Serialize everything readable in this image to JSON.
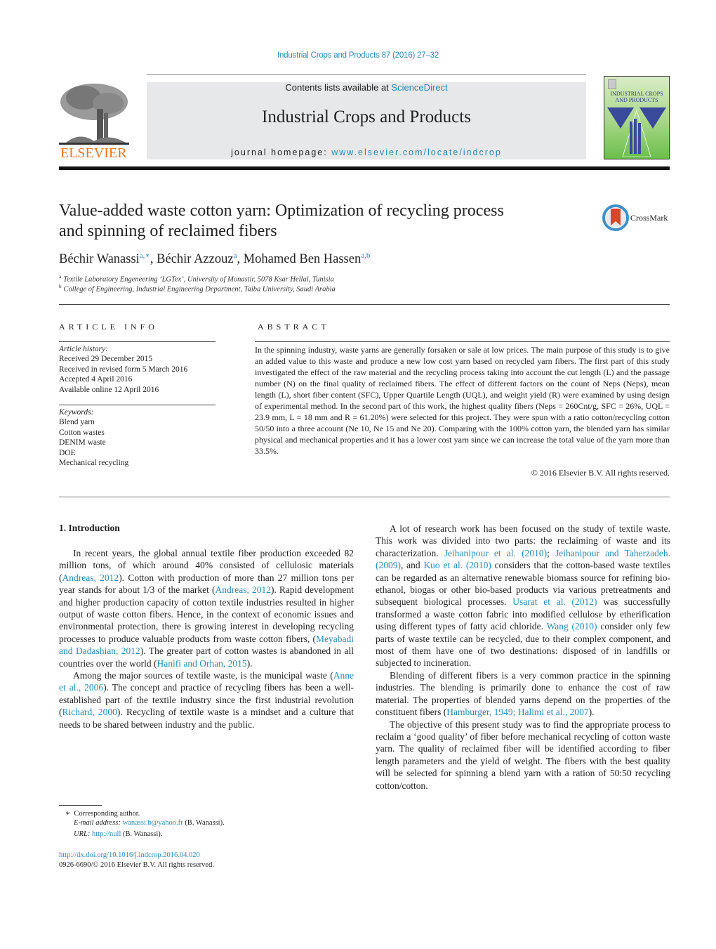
{
  "header": {
    "journal_ref": "Industrial Crops and Products 87 (2016) 27–32",
    "contents_prefix": "Contents lists available at ",
    "contents_link": "ScienceDirect",
    "journal_title": "Industrial Crops and Products",
    "homepage_prefix": "journal homepage: ",
    "homepage_link": "www.elsevier.com/locate/indcrop",
    "publisher_logo_text": "ELSEVIER",
    "cover_title": "INDUSTRIAL CROPS AND PRODUCTS"
  },
  "article": {
    "title_line1": "Value-added waste cotton yarn: Optimization of recycling process",
    "title_line2": "and spinning of reclaimed fibers",
    "crossmark_label": "CrossMark",
    "authors": [
      {
        "name": "Béchir Wanassi",
        "sup": "a,∗"
      },
      {
        "name": "Béchir Azzouz",
        "sup": "a"
      },
      {
        "name": "Mohamed Ben Hassen",
        "sup": "a,b"
      }
    ],
    "affiliations": [
      {
        "key": "a",
        "text": "Textile Laboratory Engeneering ‘LGTex’, University of Monastir, 5078 Ksar Hellal, Tunisia"
      },
      {
        "key": "b",
        "text": "College of Engineering, Industrial Engineering Department, Taiba University, Saudi Arabia"
      }
    ]
  },
  "article_info": {
    "heading": "ARTICLE INFO",
    "history_label": "Article history:",
    "history": [
      "Received 29 December 2015",
      "Received in revised form 5 March 2016",
      "Accepted 4 April 2016",
      "Available online 12 April 2016"
    ],
    "keywords_label": "Keywords:",
    "keywords": [
      "Blend yarn",
      "Cotton wastes",
      "DENIM waste",
      "DOE",
      "Mechanical recycling"
    ]
  },
  "abstract": {
    "heading": "ABSTRACT",
    "text": "In the spinning industry, waste yarns are generally forsaken or sale at low prices. The main purpose of this study is to give an added value to this waste and produce a new low cost yarn based on recycled yarn fibers. The first part of this study investigated the effect of the raw material and the recycling process taking into account the cut length (L) and the passage number (N) on the final quality of reclaimed fibers. The effect of different factors on the count of Neps (Neps), mean length (L), short fiber content (SFC), Upper Quartile Length (UQL), and weight yield (R) were examined by using design of experimental method. In the second part of this work, the highest quality fibers (Neps = 260Cnt/g, SFC = 26%, UQL = 23.9 mm, L = 18 mm and R = 61.20%) were selected for this project. They were spun with a ratio cotton/recycling cotton 50/50 into a three account (Ne 10, Ne 15 and Ne 20). Comparing with the 100% cotton yarn, the blended yarn has similar physical and mechanical properties and it has a lower cost yarn since we can increase the total value of the yarn more than 33.5%.",
    "copyright": "© 2016 Elsevier B.V. All rights reserved."
  },
  "body": {
    "section_heading": "1.  Introduction",
    "left_col": [
      [
        {
          "t": "In recent years, the global annual textile fiber production exceeded 82 million tons, of which around 40% consisted of cellulosic materials ("
        },
        {
          "t": "Andreas, 2012",
          "link": true
        },
        {
          "t": "). Cotton with production of more than 27 million tons per year stands for about 1/3 of the market ("
        },
        {
          "t": "Andreas, 2012",
          "link": true
        },
        {
          "t": "). Rapid development and higher production capacity of cotton textile industries resulted in higher output of waste cotton fibers. Hence, in the context of economic issues and environmental protection, there is growing interest in developing recycling processes to produce valuable products from waste cotton fibers, ("
        },
        {
          "t": "Meyabadi and Dadashian, 2012",
          "link": true
        },
        {
          "t": "). The greater part of cotton wastes is abandoned in all countries over the world ("
        },
        {
          "t": "Hanifi and Orhan, 2015",
          "link": true
        },
        {
          "t": ")."
        }
      ],
      [
        {
          "t": "Among the major sources of textile waste, is the municipal waste ("
        },
        {
          "t": "Anne et al., 2006",
          "link": true
        },
        {
          "t": "). The concept and practice of recycling fibers has been a well-established part of the textile industry since the first industrial revolution ("
        },
        {
          "t": "Richard, 2000",
          "link": true
        },
        {
          "t": "). Recycling of textile waste is a mindset and a culture that needs to be shared between industry and the public."
        }
      ]
    ],
    "right_col": [
      [
        {
          "t": "A lot of research work has been focused on the study of textile waste. This work was divided into two parts: the reclaiming of waste and its characterization. "
        },
        {
          "t": "Jeihanipour et al. (2010)",
          "link": true
        },
        {
          "t": "; "
        },
        {
          "t": "Jeihanipour and Taherzadeh. (2009)",
          "link": true
        },
        {
          "t": ", and "
        },
        {
          "t": "Kuo et al. (2010)",
          "link": true
        },
        {
          "t": " considers that the cotton-based waste textiles can be regarded as an alternative renewable biomass source for refining bio-ethanol, biogas or other bio-based products via various pretreatments and subsequent biological processes. "
        },
        {
          "t": "Usarat et al. (2012)",
          "link": true
        },
        {
          "t": " was successfully transformed a waste cotton fabric into modified cellulose by etherification using different types of fatty acid chloride. "
        },
        {
          "t": "Wang (2010)",
          "link": true
        },
        {
          "t": " consider only few parts of waste textile can be recycled, due to their complex component, and most of them have one of two destinations: disposed of in landfills or subjected to incineration."
        }
      ],
      [
        {
          "t": "Blending of different fibers is a very common practice in the spinning industries. The blending is primarily done to enhance the cost of raw material. The properties of blended yarns depend on the properties of the constituent fibers ("
        },
        {
          "t": "Hamburger, 1949; Halimi et al., 2007",
          "link": true
        },
        {
          "t": ")."
        }
      ],
      [
        {
          "t": "The objective of this present study was to find the appropriate process to reclaim a ‘good quality’ of fiber before mechanical recycling of cotton waste yarn. The quality of reclaimed fiber will be identified according to fiber length parameters and the yield of weight. The fibers with the best quality will be selected for spinning a blend yarn with a ration of 50:50 recycling cotton/cotton."
        }
      ]
    ]
  },
  "footnotes": {
    "star": "∗",
    "corresponding": "Corresponding author.",
    "email_label": "E-mail address:",
    "email": "wanassi.b@yahoo.fr",
    "email_suffix": " (B. Wanassi).",
    "url_label": "URL:",
    "url": "http://null",
    "url_suffix": " (B. Wanassi).",
    "doi": "http://dx.doi.org/10.1016/j.indcrop.2016.04.020",
    "issn": "0926-6690/© 2016 Elsevier B.V. All rights reserved."
  },
  "colors": {
    "link": "#2a8ab8",
    "elsevier_orange": "#e87722",
    "banner_bg": "#e7e8e9"
  }
}
